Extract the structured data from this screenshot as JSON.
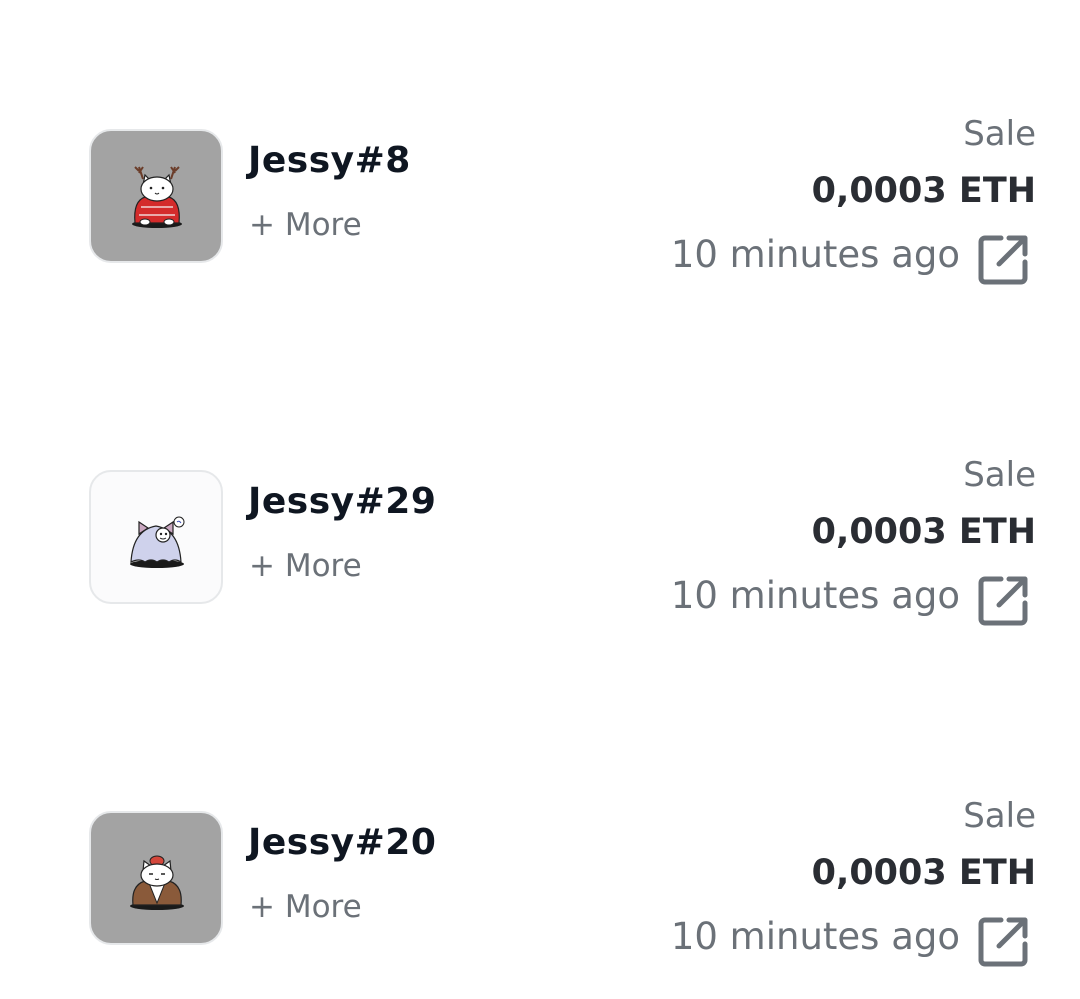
{
  "colors": {
    "name_text": "#0f1621",
    "muted_text": "#6b7178",
    "price_text": "#2a2d33",
    "thumb_border": "#e6e8ea"
  },
  "activity": [
    {
      "name": "Jessy#8",
      "more_label": "+ More",
      "event": "Sale",
      "price": "0,0003 ETH",
      "time": "10 minutes ago",
      "thumbnail": {
        "background": "#a3a3a3",
        "variant": "reindeer-antlers-red-sweater"
      },
      "link_icon": "external-link-icon"
    },
    {
      "name": "Jessy#29",
      "more_label": "+ More",
      "event": "Sale",
      "price": "0,0003 ETH",
      "time": "10 minutes ago",
      "thumbnail": {
        "background": "#fbfbfc",
        "variant": "ghost-sheet"
      },
      "link_icon": "external-link-icon"
    },
    {
      "name": "Jessy#20",
      "more_label": "+ More",
      "event": "Sale",
      "price": "0,0003 ETH",
      "time": "10 minutes ago",
      "thumbnail": {
        "background": "#a3a3a3",
        "variant": "red-hat-brown-jacket"
      },
      "link_icon": "external-link-icon"
    }
  ]
}
